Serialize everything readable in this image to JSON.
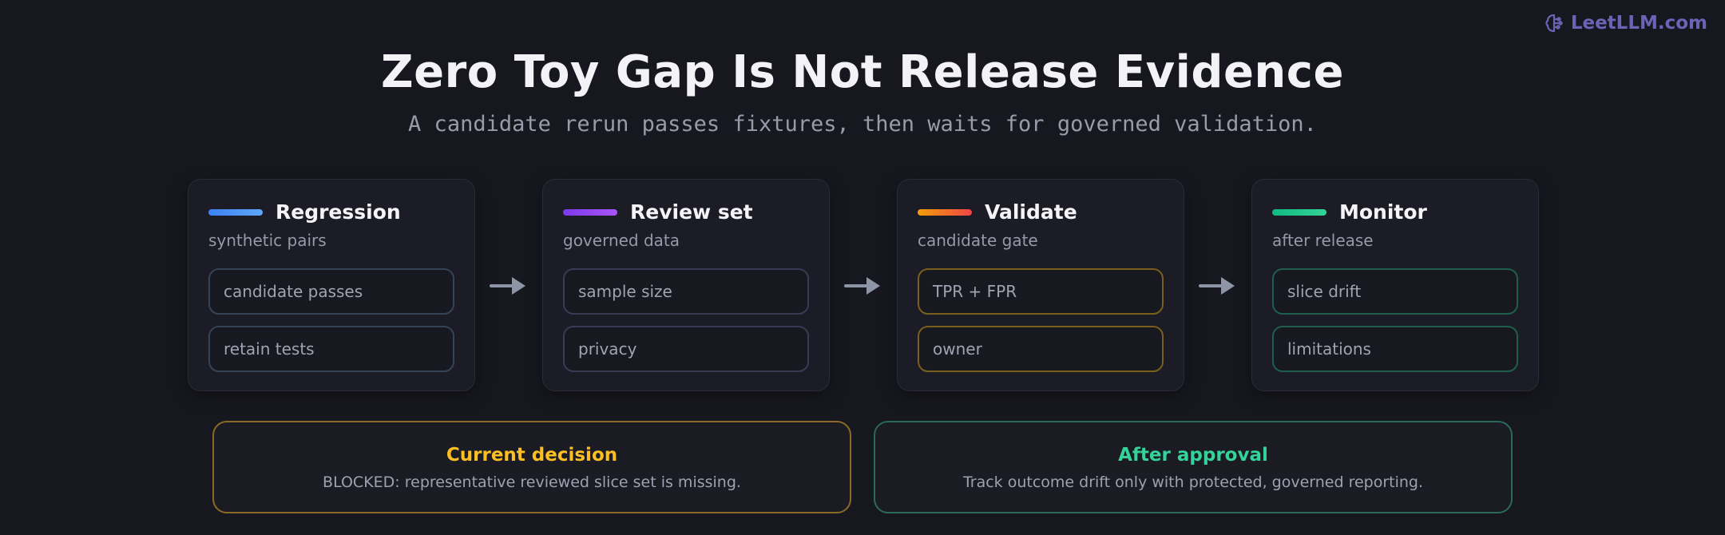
{
  "brand": {
    "label": "LeetLLM.com",
    "icon": "brain-icon",
    "color": "#6b63b5"
  },
  "header": {
    "title": "Zero Toy Gap Is Not Release Evidence",
    "subtitle": "A candidate rerun passes fixtures, then waits for governed validation."
  },
  "stages": [
    {
      "name": "Regression",
      "subtitle": "synthetic pairs",
      "accent": [
        "#3b82f6",
        "#60a5fa"
      ],
      "items": [
        "candidate passes",
        "retain tests"
      ],
      "item_border": "#344456"
    },
    {
      "name": "Review set",
      "subtitle": "governed data",
      "accent": [
        "#7c3aed",
        "#a855f7"
      ],
      "items": [
        "sample size",
        "privacy"
      ],
      "item_border": "#3a3a54"
    },
    {
      "name": "Validate",
      "subtitle": "candidate gate",
      "accent": [
        "#f59e0b",
        "#ef4444"
      ],
      "items": [
        "TPR + FPR",
        "owner"
      ],
      "item_border": "#7a5e1c"
    },
    {
      "name": "Monitor",
      "subtitle": "after release",
      "accent": [
        "#10b981",
        "#34d399"
      ],
      "items": [
        "slice drift",
        "limitations"
      ],
      "item_border": "#1f5e4d"
    }
  ],
  "arrow_color": "#8e95a6",
  "decisions": [
    {
      "title": "Current decision",
      "text": "BLOCKED: representative reviewed slice set is missing.",
      "color": "#fbbf24",
      "border": "#8a6a24"
    },
    {
      "title": "After approval",
      "text": "Track outcome drift only with protected, governed reporting.",
      "color": "#34d399",
      "border": "#2a6a5c"
    }
  ]
}
